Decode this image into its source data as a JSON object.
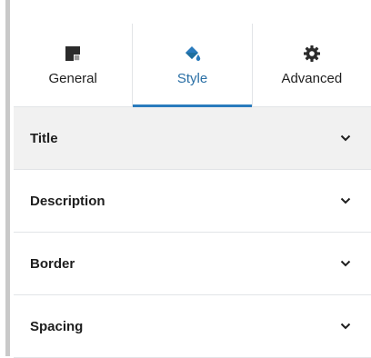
{
  "tabs": [
    {
      "label": "General",
      "icon": "layout-block-icon",
      "active": false
    },
    {
      "label": "Style",
      "icon": "paint-bucket-icon",
      "active": true
    },
    {
      "label": "Advanced",
      "icon": "gear-icon",
      "active": false
    }
  ],
  "sections": [
    {
      "label": "Title",
      "highlighted": true
    },
    {
      "label": "Description",
      "highlighted": false
    },
    {
      "label": "Border",
      "highlighted": false
    },
    {
      "label": "Spacing",
      "highlighted": false
    }
  ],
  "colors": {
    "accent": "#2a7bbd",
    "active_text": "#2a6fa5",
    "hover_row": "#f1f1f1",
    "divider": "#e2e4e7"
  }
}
